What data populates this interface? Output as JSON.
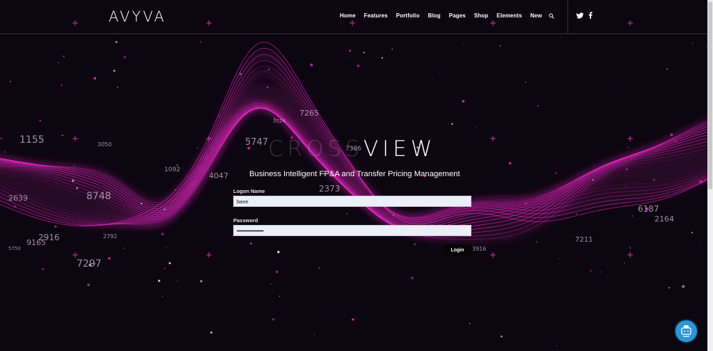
{
  "header": {
    "logo": "AVYVA",
    "nav": [
      "Home",
      "Features",
      "Portfolio",
      "Blog",
      "Pages",
      "Shop",
      "Elements",
      "New"
    ],
    "icons": [
      "search-icon",
      "twitter-icon",
      "facebook-icon"
    ]
  },
  "hero": {
    "title_faded": "CROSS",
    "title_bold": "VIEW",
    "subtitle": "Business Intelligent FP&A and Transfer Pricing Management",
    "background_numbers": [
      "1155",
      "3050",
      "2639",
      "8748",
      "2916",
      "7297",
      "4047",
      "5747",
      "7265",
      "2373",
      "7386",
      "2792",
      "1092",
      "3524",
      "5750",
      "9165",
      "7211",
      "6187",
      "2164",
      "3916"
    ]
  },
  "form": {
    "logon_label": "Logon Name",
    "logon_value": "bane",
    "password_label": "Password",
    "password_value": "••••••••••••••••••",
    "login_label": "Login"
  },
  "colors": {
    "background": "#0c0610",
    "wave_accent": "#ff2bd6",
    "input_bg": "#eceef8",
    "chat_button": "#2b97d6"
  },
  "chat_widget": {
    "icon": "chat-support-icon"
  }
}
